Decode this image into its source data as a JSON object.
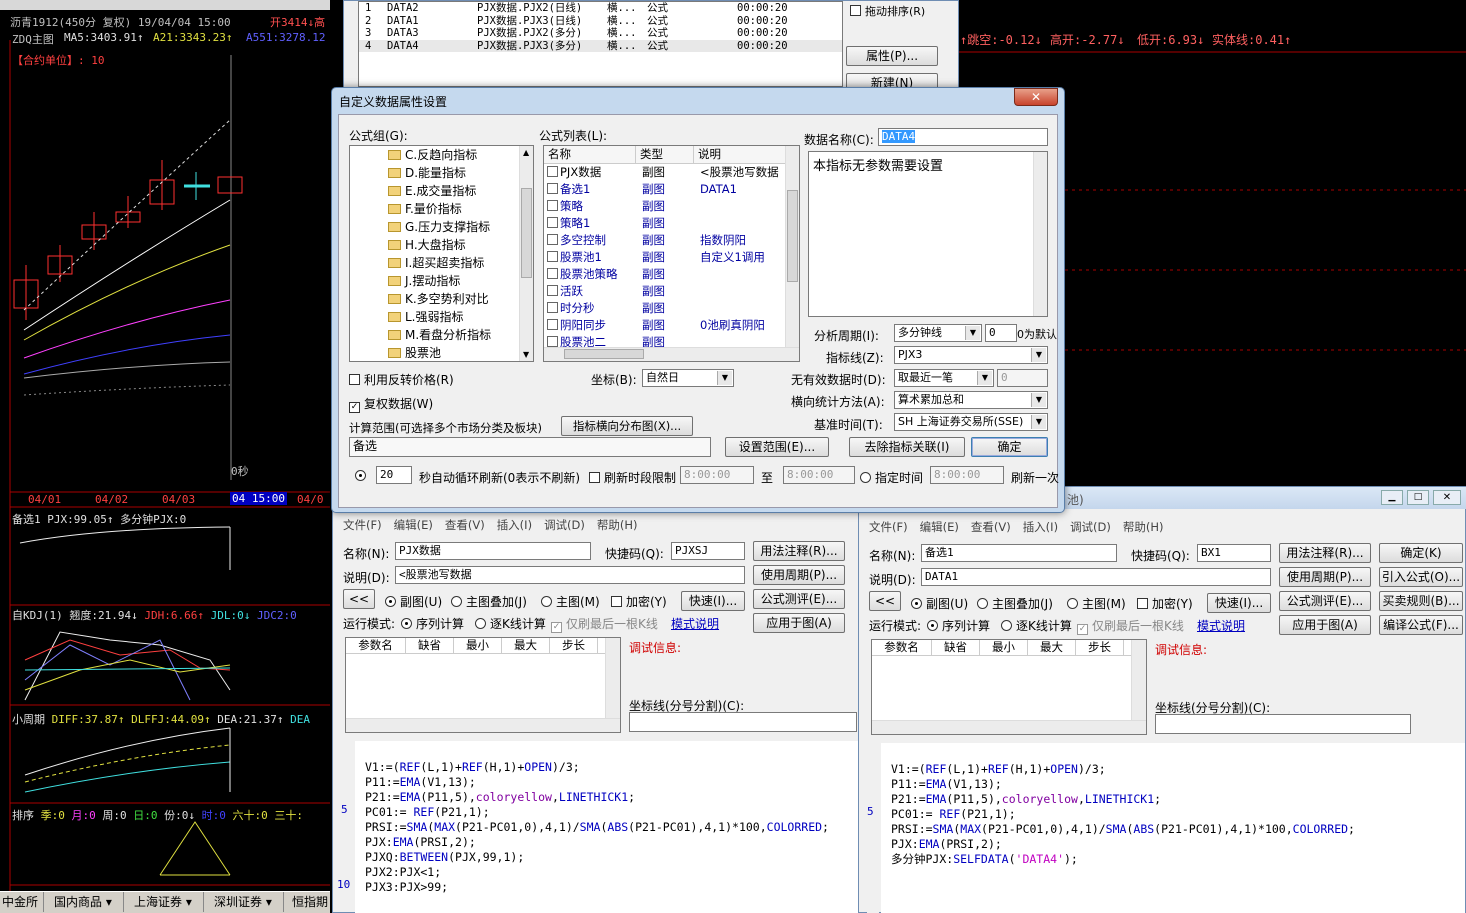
{
  "chart": {
    "header1": "沥青1912(450分 复权) 19/04/04 15:00",
    "header1_open": "开3414↓",
    "header1_high": "高",
    "ma_label": "ZDQ主图",
    "ma5": "MA5:3403.91↑",
    "a21": "A21:3343.23↑",
    "a551": "A551:3278.12",
    "unit": "【合约单位】: 10",
    "zero_sec": "0秒",
    "dates": [
      "04/01",
      "04/02",
      "04/03",
      "04 15:00",
      "04/0"
    ],
    "ind1": "备选1  PJX:99.05↑ 多分钟PJX:0",
    "kdj_label": "自KDJ(1)",
    "kdj_a": "翘度:21.94↓",
    "kdj_b": "JDH:6.66↑",
    "kdj_c": "JDL:0↓",
    "kdj_d": "JDC2:0",
    "macd_label": "小周期",
    "macd_a": "DIFF:37.87↑",
    "macd_b": "DLFFJ:44.09↑",
    "macd_c": "DEA:21.37↑",
    "macd_d": "DEA",
    "rank_label": "排序",
    "rank_a": "季:0",
    "rank_b": "月:0",
    "rank_c": "周:0",
    "rank_d": "日:0",
    "rank_e": "份:0↓",
    "rank_f": "时:0",
    "rank_g": "六十:0",
    "rank_h": "三十:",
    "tabs": [
      "中金所",
      "国内商品 ▾",
      "上海证券 ▾",
      "深圳证券 ▾",
      "恒指期"
    ]
  },
  "right_strip": {
    "jump": "↑跳空:-0.12↓",
    "high": "高开:-2.77↓",
    "low": "低开:6.93↓",
    "body": "实体线:0.41↑"
  },
  "top_list": {
    "rows": [
      [
        "1",
        "DATA2",
        "PJX数据.PJX2(日线)",
        "横...",
        "公式",
        "00:00:20"
      ],
      [
        "2",
        "DATA1",
        "PJX数据.PJX3(日线)",
        "横...",
        "公式",
        "00:00:20"
      ],
      [
        "3",
        "DATA3",
        "PJX数据.PJX2(多分)",
        "横...",
        "公式",
        "00:00:20"
      ],
      [
        "4",
        "DATA4",
        "PJX数据.PJX3(多分)",
        "横...",
        "公式",
        "00:00:20"
      ]
    ],
    "drag_sort": "拖动排序(R)",
    "props_btn": "属性(P)...",
    "new_btn": "新建(N)"
  },
  "dialog": {
    "title": "自定义数据属性设置",
    "group_label": "公式组(G):",
    "groups": [
      "C.反趋向指标",
      "D.能量指标",
      "E.成交量指标",
      "F.量价指标",
      "G.压力支撑指标",
      "H.大盘指标",
      "I.超买超卖指标",
      "J.摆动指标",
      "K.多空势利对比",
      "L.强弱指标",
      "M.看盘分析指标",
      "股票池"
    ],
    "list_label": "公式列表(L):",
    "col_name": "名称",
    "col_type": "类型",
    "col_desc": "说明",
    "formulas": [
      [
        "PJX数据",
        "副图",
        "<股票池写数据"
      ],
      [
        "备选1",
        "副图",
        "DATA1"
      ],
      [
        "策略",
        "副图",
        ""
      ],
      [
        "策略1",
        "副图",
        ""
      ],
      [
        "多空控制",
        "副图",
        "指数阴阳"
      ],
      [
        "股票池1",
        "副图",
        "自定义1调用"
      ],
      [
        "股票池策略",
        "副图",
        ""
      ],
      [
        "活跃",
        "副图",
        ""
      ],
      [
        "时分秒",
        "副图",
        ""
      ],
      [
        "阴阳同步",
        "副图",
        "0池刷真阴阳"
      ],
      [
        "股票池二",
        "副图",
        ""
      ]
    ],
    "dataname_label": "数据名称(C):",
    "dataname_value": "DATA4",
    "param_text": "本指标无参数需要设置",
    "period_label": "分析周期(I):",
    "period_value": "多分钟线",
    "period_num": "0",
    "period_hint": "0为默认",
    "line_label": "指标线(Z):",
    "line_value": "PJX3",
    "reverse_price": "利用反转价格(R)",
    "coord_label": "坐标(B):",
    "coord_value": "自然日",
    "invalid_label": "无有效数据时(D):",
    "invalid_value": "取最近一笔",
    "invalid_num": "0",
    "restore": "复权数据(W)",
    "method_label": "横向统计方法(A):",
    "method_value": "算术累加总和",
    "range_label": "计算范围(可选择多个市场分类及板块)",
    "dist_btn": "指标横向分布图(X)...",
    "base_label": "基准时间(T):",
    "base_value": "SH 上海证券交易所(SSE)",
    "range_value": "备选",
    "set_range_btn": "设置范围(E)...",
    "remove_btn": "去除指标关联(I)",
    "ok_btn": "确定",
    "loop_value": "20",
    "loop_label": "秒自动循环刷新(0表示不刷新)",
    "limit_label": "刷新时段限制",
    "t1": "8:00:00",
    "to": "至",
    "t2": "8:00:00",
    "fixed_label": "指定时间",
    "t3": "8:00:00",
    "once": "刷新一次"
  },
  "editor_common": {
    "menu": [
      "文件(F)",
      "编辑(E)",
      "查看(V)",
      "插入(I)",
      "调试(D)",
      "帮助(H)"
    ],
    "name_label": "名称(N):",
    "hotkey_label": "快捷码(Q):",
    "usage_btn": "用法注释(R)...",
    "desc_label": "说明(D):",
    "period_btn": "使用周期(P)...",
    "back_btn": "<<",
    "sub": "副图(U)",
    "overlay": "主图叠加(J)",
    "main": "主图(M)",
    "encrypt": "加密(Y)",
    "quick": "快速(I)...",
    "test_btn": "公式测评(E)...",
    "mode_label": "运行模式:",
    "seq": "序列计算",
    "step": "逐K线计算",
    "last": "仅刷最后一根K线",
    "mode_help": "模式说明",
    "apply_btn": "应用于图(A)",
    "cols": [
      "参数名",
      "缺省",
      "最小",
      "最大",
      "步长"
    ],
    "debug": "调试信息:",
    "coord": "坐标线(分号分割)(C):",
    "ok": "确定(K)",
    "import": "引入公式(O)...",
    "trade": "买卖规则(B)...",
    "compile": "编译公式(F)..."
  },
  "editor_left": {
    "name": "PJX数据",
    "hotkey": "PJXSJ",
    "desc": "<股票池写数据",
    "code": [
      "",
      "V1:=(REF(L,1)+REF(H,1)+OPEN)/3;",
      "P11:=EMA(V1,13);",
      "P21:=EMA(P11,5),coloryellow,LINETHICK1;",
      "PC01:= REF(P21,1);",
      "PRSI:=SMA(MAX(P21-PC01,0),4,1)/SMA(ABS(P21-PC01),4,1)*100,COLORRED;",
      "PJX:EMA(PRSI,2);",
      "PJXQ:BETWEEN(PJX,99,1);",
      "PJX2:PJX<1;",
      "PJX3:PJX>99;"
    ],
    "line5": "5",
    "line10": "10"
  },
  "editor_right": {
    "title_tail": "池)",
    "name": "备选1",
    "hotkey": "BX1",
    "desc": "DATA1",
    "code": [
      "",
      "V1:=(REF(L,1)+REF(H,1)+OPEN)/3;",
      "P11:=EMA(V1,13);",
      "P21:=EMA(P11,5),coloryellow,LINETHICK1;",
      "PC01:= REF(P21,1);",
      "PRSI:=SMA(MAX(P21-PC01,0),4,1)/SMA(ABS(P21-PC01),4,1)*100,COLORRED;",
      "PJX:EMA(PRSI,2);",
      "多分钟PJX:SELFDATA('DATA4');"
    ],
    "line5": "5"
  }
}
